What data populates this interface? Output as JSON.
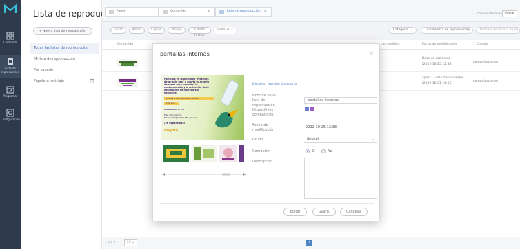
{
  "app": {
    "title": "Lista de reproducción"
  },
  "rail": {
    "items": [
      {
        "label": "Contenido",
        "icon": "content-icon"
      },
      {
        "label": "Lista de reproducción",
        "icon": "playlist-icon"
      },
      {
        "label": "Programar",
        "icon": "calendar-icon"
      },
      {
        "label": "Configuración",
        "icon": "settings-icon"
      }
    ]
  },
  "sidebar": {
    "new_button": "+ Nueva lista de reproducción",
    "items": [
      {
        "label": "Todas las listas de reproducción"
      },
      {
        "label": "Mi lista de reproducción"
      },
      {
        "label": "Por usuario"
      },
      {
        "label": "Papelera reciclaje"
      }
    ]
  },
  "tabs": [
    {
      "label": "Panel"
    },
    {
      "label": "Contenido"
    },
    {
      "label": "Lista de reproducción"
    }
  ],
  "topbar": {
    "user": "comunicaciones",
    "close": "Cerrar"
  },
  "toolbar": {
    "buttons": [
      "Editar",
      "Borrar",
      "Copiar",
      "Mover",
      "Estado revisar"
    ],
    "export": "Exportar",
    "category": "Categoría",
    "type_filter": "Tipo de lista de reproducción",
    "search_placeholder": "Nombre de la lista de rep..."
  },
  "table": {
    "columns": {
      "content": "Contenido",
      "devices": "compatibles",
      "modified": "Fecha de modificación",
      "creator": "Creador"
    },
    "rows": [
      {
        "modified_line1": "Hace un momento",
        "modified_line2": "(2022-10-25 12:38)",
        "creator": "comunicaciones"
      },
      {
        "modified_line1": "aprox. 3 días transcurridos",
        "modified_line2": "(2022-10-21 16:55)",
        "creator": "comunicaciones"
      }
    ]
  },
  "footer": {
    "range": "1 - 2 / 2",
    "per_page": "25",
    "page": "1"
  },
  "dialog": {
    "title": "pantallas internas",
    "tabs": [
      "Detalles",
      "Versión",
      "Categoría"
    ],
    "fields": {
      "name_label": "Nombre de la lista de reproducción",
      "name_value": "pantallas internas",
      "devices_label": "Dispositivos compatibles",
      "date_label": "Fecha de modificación",
      "date_value": "2022-10-25 12:38",
      "group_label": "Grupo",
      "group_value": "default",
      "share_label": "Compartir",
      "share_yes": "Sí",
      "share_no": "No",
      "desc_label": "Descripción"
    },
    "preview": {
      "headline": "Participa en la actividad \"Plásticos de un solo uso\" y aporta tu granito de arena para controlar la contaminación y la reducción de la explotación de los recursos naturales.",
      "date": "Viernes 4 de noviembre de 2022",
      "time": "9:00 a.m.",
      "mode_label": "Modalidad:",
      "mode": "virtual",
      "info_label": "Más información:",
      "email": "bienestar@ambiente.gov.co",
      "closing": "¡Te esperamos!",
      "brand": "Bogotá"
    },
    "buttons": {
      "edit": "Editar",
      "save": "Guard.",
      "cancel": "Cancelar"
    }
  }
}
